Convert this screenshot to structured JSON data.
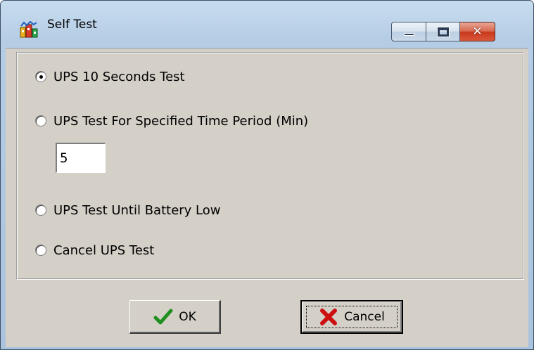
{
  "window": {
    "title": "Self Test",
    "title_buttons": {
      "minimize": "minimize-icon",
      "maximize": "maximize-icon",
      "close": "close-icon"
    }
  },
  "options": [
    {
      "label": "UPS 10 Seconds Test",
      "checked": true
    },
    {
      "label": "UPS Test For Specified Time Period (Min)",
      "checked": false
    },
    {
      "label": "UPS Test Until Battery Low",
      "checked": false
    },
    {
      "label": "Cancel UPS Test",
      "checked": false
    }
  ],
  "time_period": {
    "value": "5"
  },
  "buttons": {
    "ok": {
      "label": "OK",
      "icon": "checkmark-icon",
      "icon_color": "#1f8f1f"
    },
    "cancel": {
      "label": "Cancel",
      "icon": "x-icon",
      "icon_color": "#cc1010"
    }
  },
  "colors": {
    "face": "#d4d0c8",
    "title_gradient": "#b4cce4",
    "close_red": "#c8381c"
  }
}
